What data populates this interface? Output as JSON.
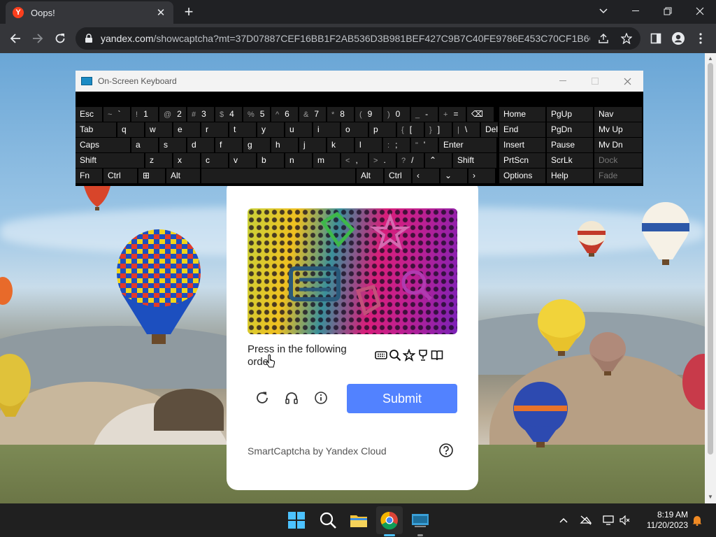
{
  "browser": {
    "tab_title": "Oops!",
    "favicon_letter": "Y",
    "url_host": "yandex.com",
    "url_rest": "/showcaptcha?mt=37D07887CEF16BB1F2AB536D3B981BEF427C9B7C40FE9786E453C70CF1B6CECC6..."
  },
  "osk": {
    "title": "On-Screen Keyboard",
    "rows": [
      [
        [
          "Esc",
          ""
        ],
        [
          "`",
          "~"
        ],
        [
          "1",
          "!"
        ],
        [
          "2",
          "@"
        ],
        [
          "3",
          "#"
        ],
        [
          "4",
          "$"
        ],
        [
          "5",
          "%"
        ],
        [
          "6",
          "^"
        ],
        [
          "7",
          "&"
        ],
        [
          "8",
          "*"
        ],
        [
          "9",
          "("
        ],
        [
          "0",
          ")"
        ],
        [
          "-",
          "_"
        ],
        [
          "=",
          "+"
        ],
        [
          "⌫",
          ""
        ],
        [
          "Home",
          ""
        ],
        [
          "PgUp",
          ""
        ],
        [
          "Nav",
          ""
        ]
      ],
      [
        [
          "Tab",
          ""
        ],
        [
          "q",
          ""
        ],
        [
          "w",
          ""
        ],
        [
          "e",
          ""
        ],
        [
          "r",
          ""
        ],
        [
          "t",
          ""
        ],
        [
          "y",
          ""
        ],
        [
          "u",
          ""
        ],
        [
          "i",
          ""
        ],
        [
          "o",
          ""
        ],
        [
          "p",
          ""
        ],
        [
          "[",
          "{"
        ],
        [
          "]",
          "}"
        ],
        [
          "\\",
          "|"
        ],
        [
          "Del",
          ""
        ],
        [
          "End",
          ""
        ],
        [
          "PgDn",
          ""
        ],
        [
          "Mv Up",
          ""
        ]
      ],
      [
        [
          "Caps",
          ""
        ],
        [
          "a",
          ""
        ],
        [
          "s",
          ""
        ],
        [
          "d",
          ""
        ],
        [
          "f",
          ""
        ],
        [
          "g",
          ""
        ],
        [
          "h",
          ""
        ],
        [
          "j",
          ""
        ],
        [
          "k",
          ""
        ],
        [
          "l",
          ""
        ],
        [
          ";",
          ":"
        ],
        [
          "'",
          "\""
        ],
        [
          "Enter",
          ""
        ],
        [
          "Insert",
          ""
        ],
        [
          "Pause",
          ""
        ],
        [
          "Mv Dn",
          ""
        ]
      ],
      [
        [
          "Shift",
          ""
        ],
        [
          "z",
          ""
        ],
        [
          "x",
          ""
        ],
        [
          "c",
          ""
        ],
        [
          "v",
          ""
        ],
        [
          "b",
          ""
        ],
        [
          "n",
          ""
        ],
        [
          "m",
          ""
        ],
        [
          ",",
          "<"
        ],
        [
          ".",
          ">"
        ],
        [
          "/",
          "?"
        ],
        [
          "⌃",
          ""
        ],
        [
          "Shift",
          ""
        ],
        [
          "PrtScn",
          ""
        ],
        [
          "ScrLk",
          ""
        ],
        [
          "Dock",
          ""
        ]
      ],
      [
        [
          "Fn",
          ""
        ],
        [
          "Ctrl",
          ""
        ],
        [
          "⊞",
          ""
        ],
        [
          "Alt",
          ""
        ],
        [
          "",
          ""
        ],
        [
          "Alt",
          ""
        ],
        [
          "Ctrl",
          ""
        ],
        [
          "‹",
          ""
        ],
        [
          "⌄",
          ""
        ],
        [
          "›",
          ""
        ],
        [
          "☰",
          ""
        ],
        [
          "Options",
          ""
        ],
        [
          "Help",
          ""
        ],
        [
          "Fade",
          ""
        ]
      ]
    ]
  },
  "captcha": {
    "instruction": "Press in the following order",
    "order_icons": [
      "keyboard-icon",
      "magnifier-icon",
      "star-icon",
      "trophy-icon",
      "book-icon"
    ],
    "submit_label": "Submit",
    "brand": "SmartCaptcha by Yandex Cloud"
  },
  "taskbar": {
    "time": "8:19 AM",
    "date": "11/20/2023"
  },
  "colors": {
    "submit": "#5282ff",
    "chrome_dark": "#202124",
    "chrome_toolbar": "#35363a"
  }
}
